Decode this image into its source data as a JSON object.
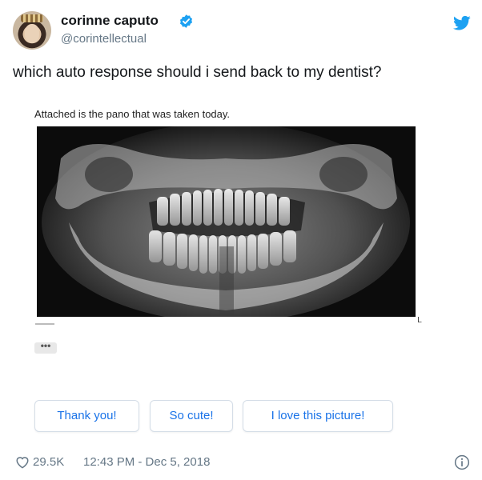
{
  "user": {
    "display_name": "corinne caputo",
    "handle": "@corintellectual",
    "verified_icon": "verified-badge-icon",
    "avatar": "avatar"
  },
  "tweet": {
    "text": "which auto response should i send back to my dentist?"
  },
  "email": {
    "body_text": "Attached is the pano that was taken today.",
    "image": "panoramic-dental-xray",
    "image_corner_mark": "L",
    "more_label": "•••"
  },
  "smart_replies": [
    {
      "label": "Thank you!"
    },
    {
      "label": "So cute!"
    },
    {
      "label": "I love this picture!"
    }
  ],
  "footer": {
    "likes": "29.5K",
    "timestamp": "12:43 PM - Dec 5, 2018",
    "heart_icon": "heart-icon",
    "info_icon": "info-icon"
  },
  "colors": {
    "twitter_blue": "#1da1f2",
    "reply_text": "#1a73e8",
    "secondary_text": "#657786"
  }
}
